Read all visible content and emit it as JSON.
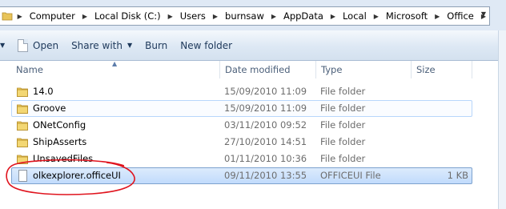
{
  "address_bar": {
    "crumbs": [
      "Computer",
      "Local Disk (C:)",
      "Users",
      "burnsaw",
      "AppData",
      "Local",
      "Microsoft",
      "Office"
    ]
  },
  "toolbar": {
    "open_label": "Open",
    "share_label": "Share with",
    "burn_label": "Burn",
    "new_folder_label": "New folder"
  },
  "columns": {
    "name": "Name",
    "date": "Date modified",
    "type": "Type",
    "size": "Size"
  },
  "files": [
    {
      "name": "14.0",
      "date": "15/09/2010 11:09",
      "type": "File folder",
      "size": "",
      "kind": "folder-icon",
      "state": "normal"
    },
    {
      "name": "Groove",
      "date": "15/09/2010 11:09",
      "type": "File folder",
      "size": "",
      "kind": "folder-icon",
      "state": "hover"
    },
    {
      "name": "ONetConfig",
      "date": "03/11/2010 09:52",
      "type": "File folder",
      "size": "",
      "kind": "folder-icon",
      "state": "normal"
    },
    {
      "name": "ShipAsserts",
      "date": "27/10/2010 14:51",
      "type": "File folder",
      "size": "",
      "kind": "folder-icon",
      "state": "normal"
    },
    {
      "name": "UnsavedFiles",
      "date": "01/11/2010 10:36",
      "type": "File folder",
      "size": "",
      "kind": "folder-icon",
      "state": "normal"
    },
    {
      "name": "olkexplorer.officeUI",
      "date": "09/11/2010 13:55",
      "type": "OFFICEUI File",
      "size": "1 KB",
      "kind": "file-icon",
      "state": "selected"
    }
  ],
  "colors": {
    "selection": "#c1dbfc",
    "annotation": "#e0141e"
  }
}
